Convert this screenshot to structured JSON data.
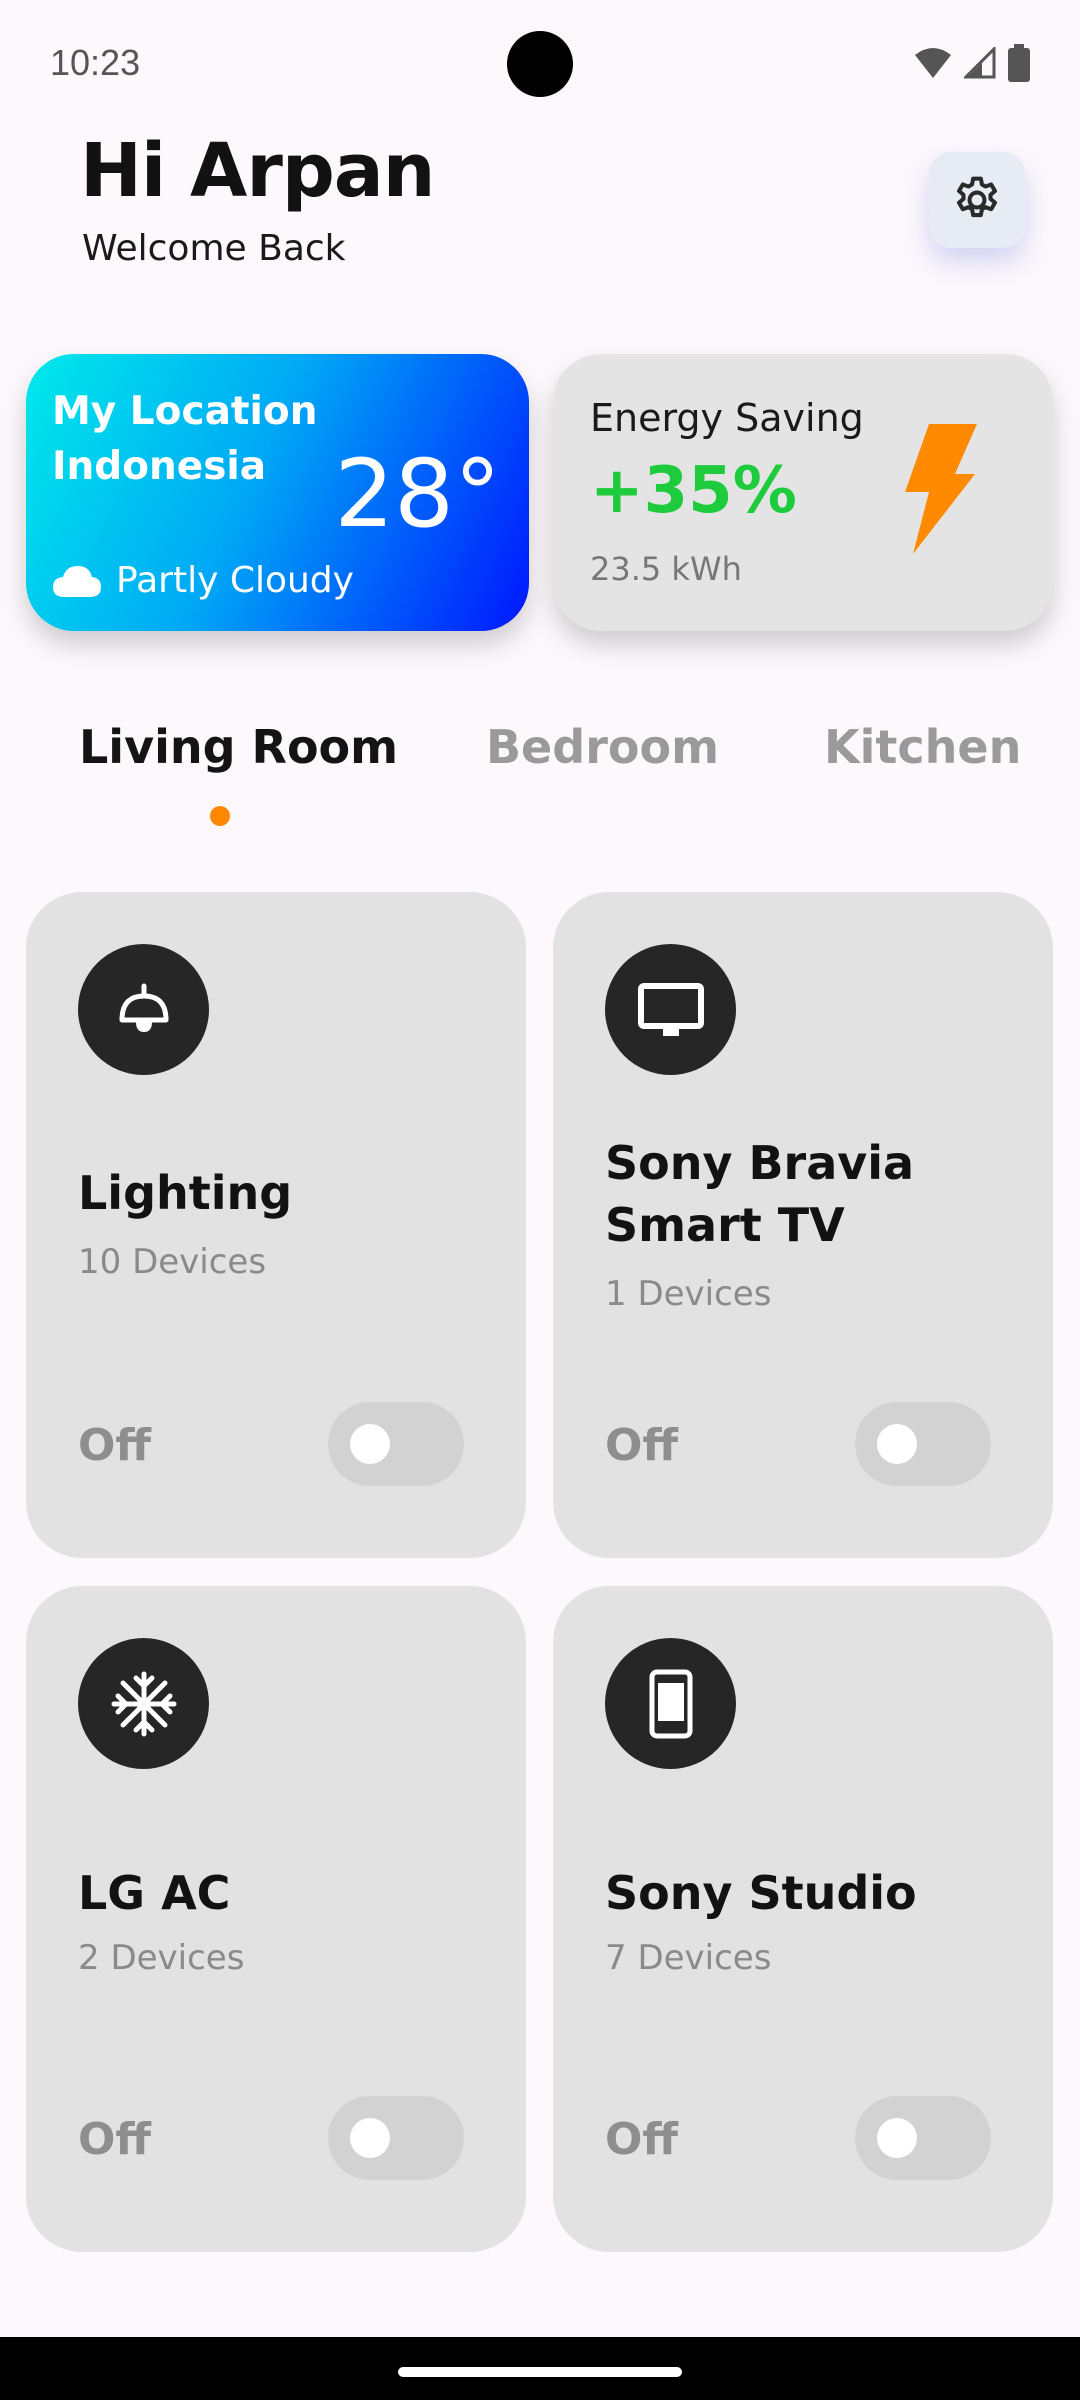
{
  "status_bar": {
    "time": "10:23"
  },
  "header": {
    "greeting": "Hi Arpan",
    "subtitle": "Welcome Back"
  },
  "weather": {
    "title_line1": "My Location",
    "title_line2": "Indonesia",
    "temperature": "28°",
    "condition": "Partly Cloudy",
    "icon": "cloud-icon"
  },
  "energy": {
    "title": "Energy Saving",
    "value": "+35%",
    "usage": "23.5 kWh",
    "icon": "lightning-icon",
    "value_color": "#1ecb3c",
    "bolt_color": "#ff8a00"
  },
  "tabs": [
    {
      "label": "Living Room",
      "active": true
    },
    {
      "label": "Bedroom",
      "active": false
    },
    {
      "label": "Kitchen",
      "active": false
    }
  ],
  "devices": [
    {
      "name": "Lighting",
      "count": "10 Devices",
      "state": "Off",
      "on": false,
      "icon": "lamp-icon"
    },
    {
      "name": "Sony Bravia Smart TV",
      "count": "1 Devices",
      "state": "Off",
      "on": false,
      "icon": "tv-icon"
    },
    {
      "name": "LG AC",
      "count": "2 Devices",
      "state": "Off",
      "on": false,
      "icon": "snowflake-icon"
    },
    {
      "name": "Sony Studio",
      "count": "7 Devices",
      "state": "Off",
      "on": false,
      "icon": "phone-icon"
    }
  ],
  "colors": {
    "accent_dot": "#ff8800",
    "card_bg": "#e2e2e2",
    "icon_bg": "#262626"
  }
}
